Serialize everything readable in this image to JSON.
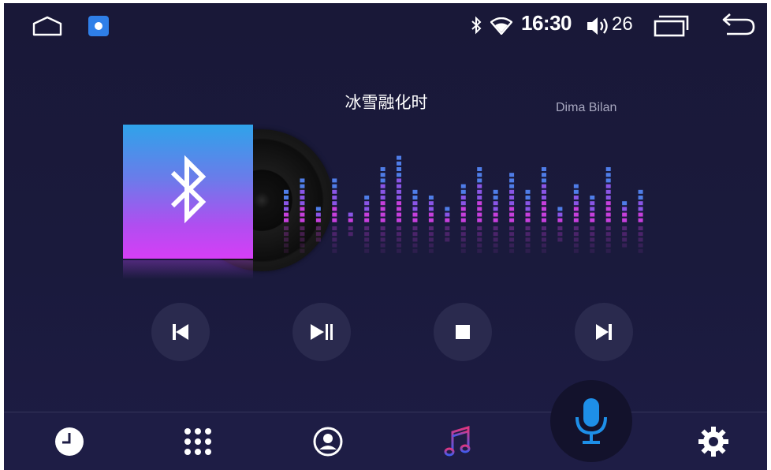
{
  "status_bar": {
    "time": "16:30",
    "volume": "26",
    "icons": [
      "home-icon",
      "app-notification-icon",
      "bluetooth-icon",
      "wifi-icon",
      "volume-icon",
      "recent-apps-icon",
      "back-icon"
    ]
  },
  "song": {
    "title": "冰雪融化时",
    "artist": "Dima Bilan"
  },
  "spectrum": {
    "levels": [
      0.45,
      0.6,
      0.25,
      0.55,
      0.15,
      0.35,
      0.7,
      0.85,
      0.45,
      0.35,
      0.22,
      0.5,
      0.7,
      0.4,
      0.62,
      0.45,
      0.7,
      0.22,
      0.5,
      0.35,
      0.7,
      0.28,
      0.45
    ],
    "colors": [
      "#4f7de8",
      "#8a55e6",
      "#c63fdc"
    ]
  },
  "controls": [
    "previous-icon",
    "play-pause-icon",
    "stop-icon",
    "next-icon"
  ],
  "bottom_nav": {
    "items": [
      "recent-calls-icon",
      "apps-grid-icon",
      "contacts-icon",
      "music-icon",
      "microphone-icon",
      "settings-icon"
    ],
    "active_color": "#e0357f",
    "accent_color": "#1e8fe8"
  }
}
